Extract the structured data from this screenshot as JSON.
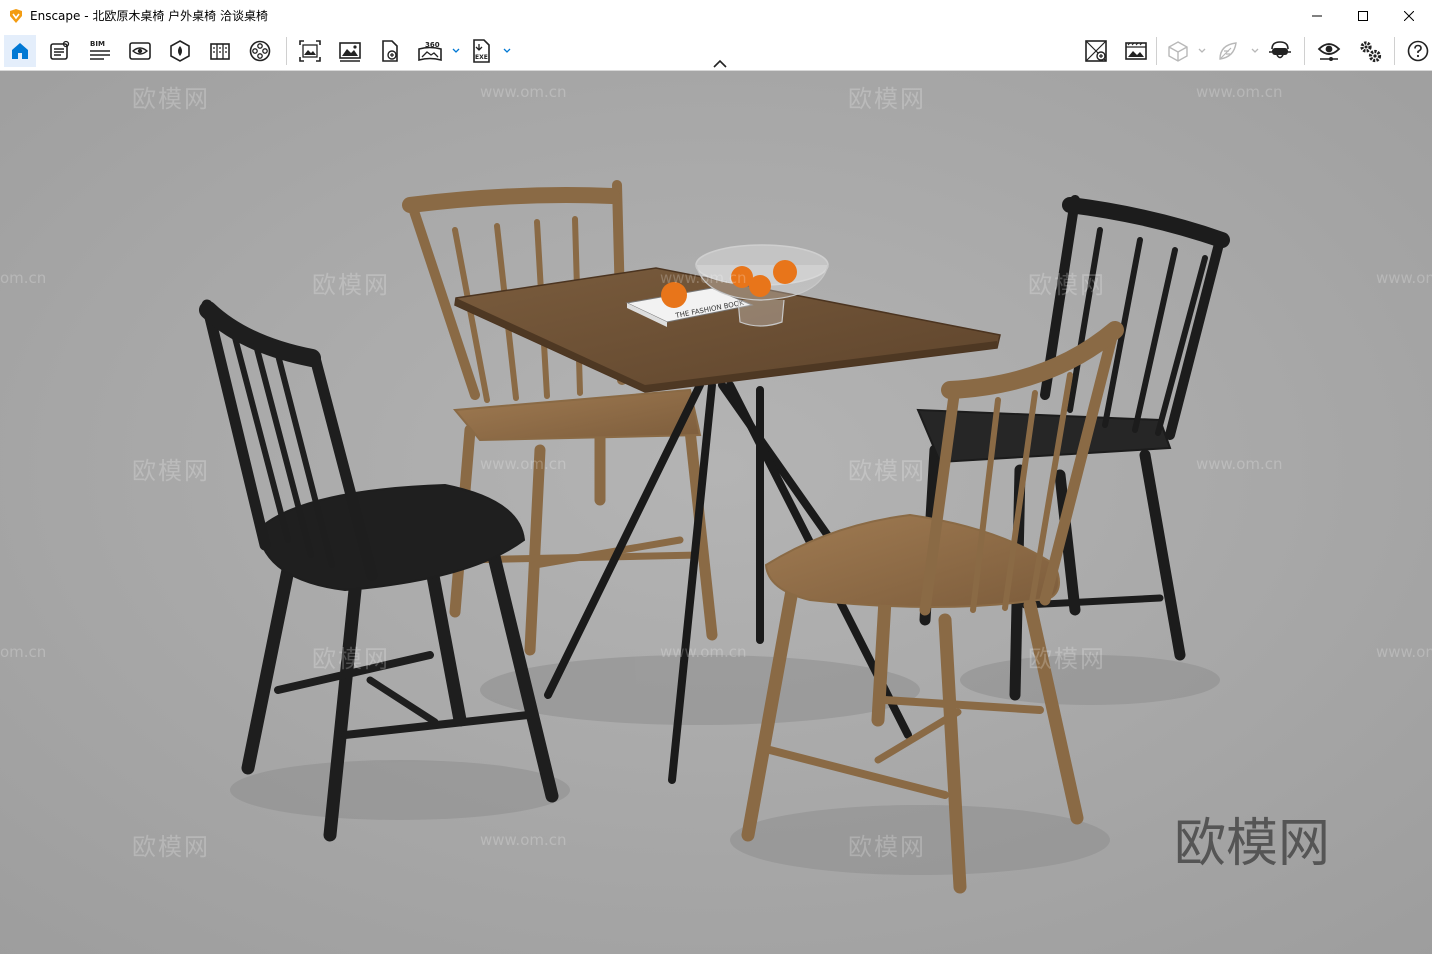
{
  "window": {
    "title": "Enscape - 北欧原木桌椅 户外桌椅 洽谈桌椅",
    "controls": [
      "minimize-icon",
      "maximize-icon",
      "close-icon"
    ]
  },
  "toolbar": {
    "bim_label": "BIM",
    "panorama_label": "360",
    "exe_label": "EXE",
    "left_icons": [
      "home-icon",
      "asset-library-icon",
      "bim-info-icon",
      "view-mode-icon",
      "material-editor-icon",
      "atlas-icon",
      "video-editor-icon",
      "batch-render-icon",
      "screenshot-icon",
      "web-standalone-icon",
      "panorama-icon",
      "exe-export-icon"
    ],
    "right_icons": [
      "cursor-display-icon",
      "screenshot-settings-icon",
      "orthographic-icon",
      "feedback-icon",
      "vr-headset-icon",
      "visual-settings-icon",
      "settings-icon",
      "help-icon"
    ]
  },
  "viewport": {
    "watermark_cn": "欧模网",
    "watermark_url": "www.om.cn",
    "watermark_url_partial": "om.cn",
    "corner_brand": "欧模网",
    "background": "#a9a9a9",
    "book_title": "THE FASHION BOOK"
  },
  "colors": {
    "accent": "#0078d4",
    "light_wood": "#8a6a45",
    "dark_wood": "#1c1c1c",
    "table_top": "#6b5035",
    "orange": "#e8751a"
  }
}
